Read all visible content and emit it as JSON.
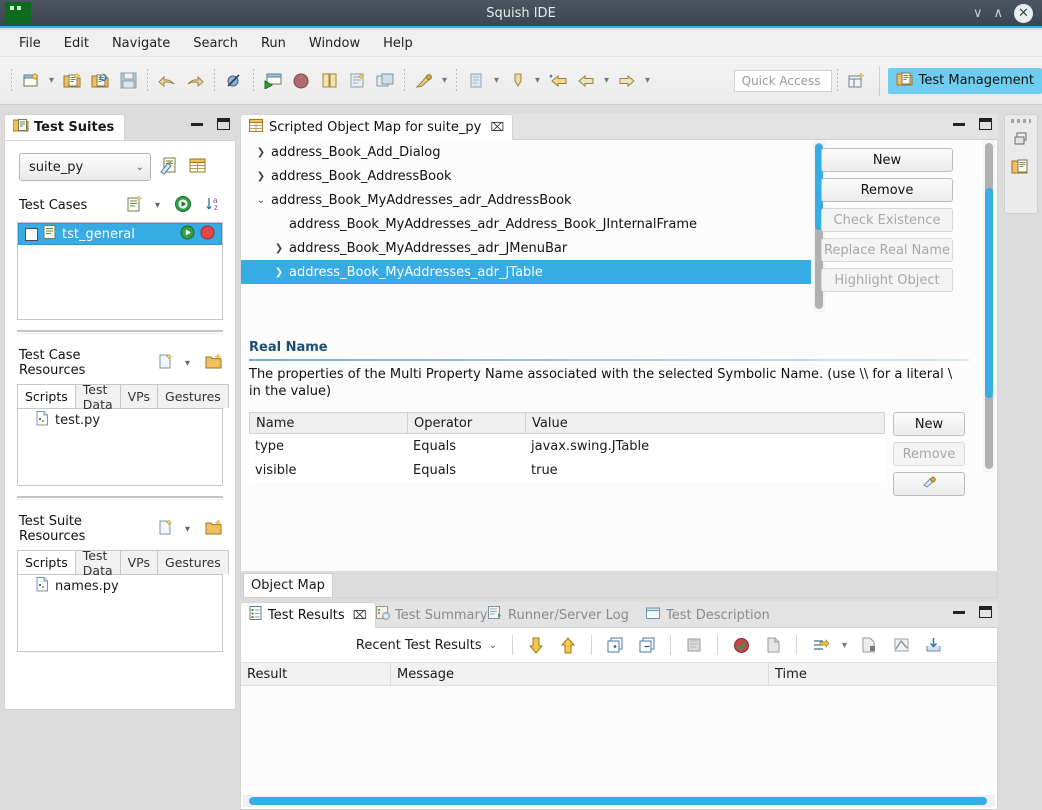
{
  "window": {
    "title": "Squish IDE",
    "controls": {
      "minimize": "∨",
      "maximize": "∧",
      "close": "✕"
    },
    "logo_icon": "squish-logo-icon"
  },
  "menubar": {
    "items": [
      "File",
      "Edit",
      "Navigate",
      "Search",
      "Run",
      "Window",
      "Help"
    ]
  },
  "toolbar": {
    "icons": [
      "new-test-suite-icon",
      "new-dropdown-caret",
      "new-test-case-icon",
      "open-test-case-icon",
      "save-icon",
      "undo-icon",
      "redo-icon",
      "toggle-breakpoint-icon",
      "run-test-suite-icon",
      "record-test-case-icon",
      "compare-icon",
      "spy-icon",
      "object-map-icon",
      "debug-icon",
      "debug-caret",
      "run-icon",
      "run-caret",
      "external-tools-icon",
      "external-caret",
      "back-history-icon",
      "back-icon",
      "back-caret",
      "forward-icon",
      "forward-caret"
    ],
    "quick_access_placeholder": "Quick Access",
    "open_perspective_icon": "open-perspective-icon",
    "perspective_label": "Test Management",
    "perspective_icon": "test-management-icon",
    "perspective_color": "#6fcdf0"
  },
  "test_suites_view": {
    "tab_label": "Test Suites",
    "tab_icon": "test-suites-icon",
    "minimize_tooltip": "Minimize",
    "maximize_tooltip": "Maximize",
    "suite_combo": {
      "value": "suite_py",
      "caret": "⌄"
    },
    "suite_actions": [
      "edit-suite-settings-icon",
      "suite-properties-icon"
    ],
    "test_cases": {
      "title": "Test Cases",
      "actions": [
        "new-test-case-icon",
        "new-test-case-caret",
        "run-all-tests-icon",
        "sort-az-icon"
      ],
      "items": [
        {
          "name": "tst_general",
          "selected": true,
          "checked": false,
          "icon": "test-case-icon",
          "run_icon": "run-icon",
          "stop_icon": "stop-icon"
        }
      ]
    },
    "test_case_resources": {
      "title": "Test Case Resources",
      "actions": [
        "new-file-icon",
        "new-file-caret",
        "new-folder-icon"
      ],
      "tabs": [
        "Scripts",
        "Test Data",
        "VPs",
        "Gestures"
      ],
      "active_tab": "Scripts",
      "files": [
        {
          "name": "test.py",
          "icon": "python-file-icon"
        }
      ]
    },
    "test_suite_resources": {
      "title": "Test Suite Resources",
      "actions": [
        "new-file-icon",
        "new-file-caret",
        "new-folder-icon"
      ],
      "tabs": [
        "Scripts",
        "Test Data",
        "VPs",
        "Gestures"
      ],
      "active_tab": "Scripts",
      "files": [
        {
          "name": "names.py",
          "icon": "python-file-icon"
        }
      ]
    }
  },
  "editor": {
    "tab_label": "Scripted Object Map for suite_py",
    "tab_icon": "object-map-icon",
    "tab_close": "⌧",
    "tree": [
      {
        "label": "address_Book_Add_Dialog",
        "depth": 0,
        "expander": "collapsed",
        "selected": false
      },
      {
        "label": "address_Book_AddressBook",
        "depth": 0,
        "expander": "collapsed",
        "selected": false
      },
      {
        "label": "address_Book_MyAddresses_adr_AddressBook",
        "depth": 0,
        "expander": "expanded",
        "selected": false
      },
      {
        "label": "address_Book_MyAddresses_adr_Address_Book_JInternalFrame",
        "depth": 1,
        "expander": "none",
        "selected": false
      },
      {
        "label": "address_Book_MyAddresses_adr_JMenuBar",
        "depth": 1,
        "expander": "collapsed",
        "selected": false
      },
      {
        "label": "address_Book_MyAddresses_adr_JTable",
        "depth": 1,
        "expander": "collapsed",
        "selected": true
      }
    ],
    "tree_buttons": [
      {
        "label": "New",
        "enabled": true
      },
      {
        "label": "Remove",
        "enabled": true
      },
      {
        "label": "Check Existence",
        "enabled": false
      },
      {
        "label": "Replace Real Name",
        "enabled": false
      },
      {
        "label": "Highlight Object",
        "enabled": false
      }
    ],
    "real_name": {
      "title": "Real Name",
      "description": "The properties of the Multi Property Name associated with the selected Symbolic Name. (use \\\\ for a literal \\ in the value)",
      "columns": [
        "Name",
        "Operator",
        "Value"
      ],
      "rows": [
        {
          "name": "type",
          "operator": "Equals",
          "value": "javax.swing.JTable"
        },
        {
          "name": "visible",
          "operator": "Equals",
          "value": "true"
        }
      ],
      "buttons": [
        {
          "label": "New",
          "enabled": true
        },
        {
          "label": "Remove",
          "enabled": false
        },
        {
          "label": "",
          "enabled": true,
          "icon": "properties-picker-icon"
        }
      ]
    },
    "bottom_tab": "Object Map"
  },
  "test_results_view": {
    "tabs": [
      {
        "label": "Test Results",
        "icon": "test-results-icon",
        "active": true,
        "close": "⌧"
      },
      {
        "label": "Test Summary",
        "icon": "test-summary-icon",
        "active": false
      },
      {
        "label": "Runner/Server Log",
        "icon": "runner-log-icon",
        "active": false
      },
      {
        "label": "Test Description",
        "icon": "test-description-icon",
        "active": false
      }
    ],
    "toolbar": {
      "filter_label": "Recent Test Results",
      "filter_caret": "⌄",
      "icons": [
        "next-failure-icon",
        "previous-failure-icon",
        "expand-all-icon",
        "collapse-all-icon",
        "clear-results-icon",
        "filter-passes-icon",
        "delete-results-icon",
        "sort-results-icon",
        "sort-caret",
        "export-results-icon",
        "export-xml-icon",
        "import-results-icon"
      ]
    },
    "columns": [
      "Result",
      "Message",
      "Time"
    ],
    "rows": []
  },
  "right_bar": {
    "icons": [
      "restore-icon",
      "test-suites-icon"
    ]
  },
  "colors": {
    "selection": "#37abe3",
    "titlebar": "#3c4650",
    "accent": "#29b6e8",
    "section_title": "#1d4f73",
    "perspective": "#6fcdf0"
  }
}
